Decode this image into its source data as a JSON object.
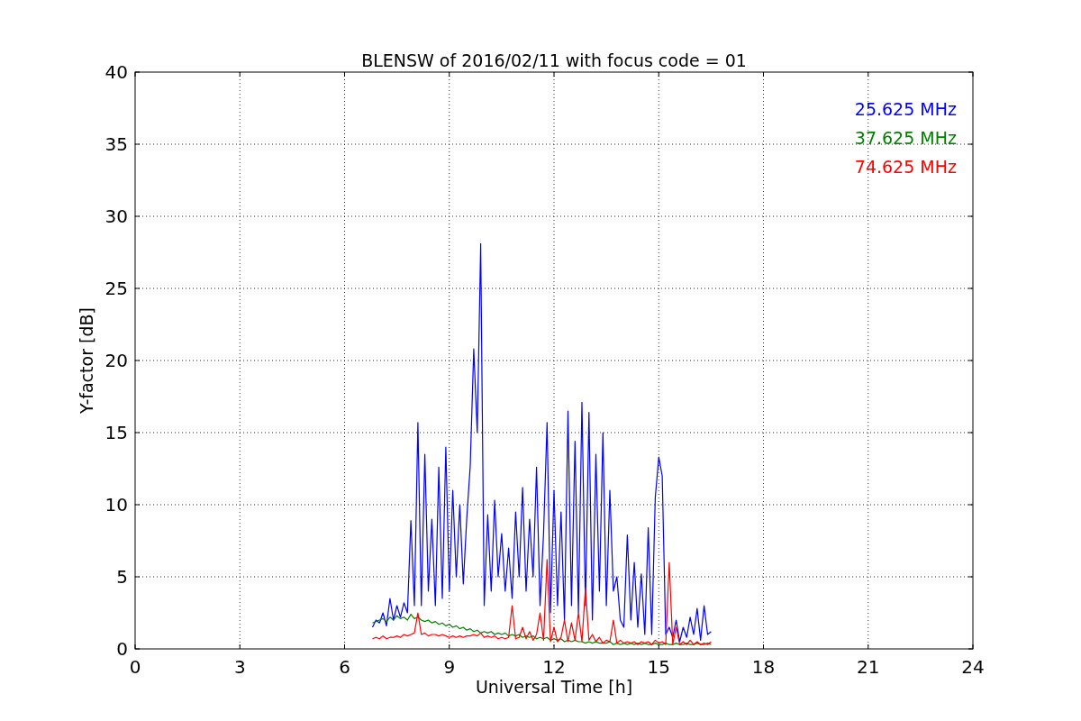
{
  "chart_data": {
    "type": "line",
    "title": "BLENSW of 2016/02/11 with focus code = 01",
    "xlabel": "Universal Time [h]",
    "ylabel": "Y-factor [dB]",
    "xlim": [
      0,
      24
    ],
    "ylim": [
      0,
      40
    ],
    "xticks": [
      0,
      3,
      6,
      9,
      12,
      15,
      18,
      21,
      24
    ],
    "yticks": [
      0,
      5,
      10,
      15,
      20,
      25,
      30,
      35,
      40
    ],
    "grid": true,
    "x": [
      6.8,
      6.9,
      7.0,
      7.1,
      7.2,
      7.3,
      7.4,
      7.5,
      7.6,
      7.7,
      7.8,
      7.9,
      8.0,
      8.1,
      8.2,
      8.3,
      8.4,
      8.5,
      8.6,
      8.7,
      8.8,
      8.9,
      9.0,
      9.1,
      9.2,
      9.3,
      9.4,
      9.5,
      9.6,
      9.7,
      9.8,
      9.9,
      10.0,
      10.1,
      10.2,
      10.3,
      10.4,
      10.5,
      10.6,
      10.7,
      10.8,
      10.9,
      11.0,
      11.1,
      11.2,
      11.3,
      11.4,
      11.5,
      11.6,
      11.7,
      11.8,
      11.9,
      12.0,
      12.1,
      12.2,
      12.3,
      12.4,
      12.5,
      12.6,
      12.7,
      12.8,
      12.9,
      13.0,
      13.1,
      13.2,
      13.3,
      13.4,
      13.5,
      13.6,
      13.7,
      13.8,
      13.9,
      14.0,
      14.1,
      14.2,
      14.3,
      14.4,
      14.5,
      14.6,
      14.7,
      14.8,
      14.9,
      15.0,
      15.1,
      15.2,
      15.3,
      15.4,
      15.5,
      15.6,
      15.7,
      15.8,
      15.9,
      16.0,
      16.1,
      16.2,
      16.3,
      16.4,
      16.5
    ],
    "series": [
      {
        "name": "25.625 MHz",
        "color": "#0000ff",
        "values": [
          1.5,
          2,
          1.8,
          2.5,
          1.6,
          3.5,
          2,
          3,
          2.2,
          3.2,
          2.5,
          8.9,
          3,
          15.7,
          3,
          13.5,
          4,
          9,
          3,
          12.6,
          3.5,
          14,
          4,
          11,
          5,
          10,
          4.5,
          9,
          12.7,
          20.8,
          15,
          28.1,
          3,
          9.3,
          4,
          10.3,
          5,
          8,
          4,
          7,
          3.5,
          9.5,
          5,
          11.2,
          4,
          9,
          5,
          12.6,
          3,
          8,
          15.7,
          2.5,
          11,
          3,
          9.5,
          2,
          16.5,
          3,
          14.4,
          2.5,
          17.1,
          3,
          16.4,
          2,
          13.5,
          4,
          15,
          3,
          11,
          4,
          5,
          2,
          1.5,
          7.9,
          2,
          6,
          1.5,
          5.2,
          1,
          8.4,
          1,
          10.5,
          13.3,
          12,
          1,
          1.5,
          0.8,
          2,
          0.5,
          1.5,
          0.8,
          2.2,
          1,
          2.8,
          0.6,
          3,
          1,
          1.2
        ]
      },
      {
        "name": "37.625 MHz",
        "color": "#008000",
        "values": [
          1.8,
          1.9,
          2,
          2.1,
          1.9,
          2.2,
          2,
          2.3,
          2.1,
          2.2,
          2,
          2.4,
          2.1,
          2.2,
          2,
          1.9,
          2,
          1.8,
          1.9,
          1.7,
          1.8,
          1.6,
          1.7,
          1.5,
          1.6,
          1.4,
          1.5,
          1.3,
          1.4,
          1.2,
          1.3,
          1.1,
          1.2,
          1.1,
          1.2,
          1,
          1.1,
          1,
          1.1,
          0.9,
          1,
          0.9,
          1,
          0.8,
          0.9,
          0.8,
          0.9,
          0.7,
          0.8,
          0.7,
          0.8,
          0.6,
          0.7,
          0.6,
          0.7,
          0.5,
          0.6,
          0.5,
          0.6,
          0.5,
          0.5,
          0.4,
          0.5,
          0.4,
          0.5,
          0.4,
          0.4,
          0.4,
          0.5,
          0.3,
          0.4,
          0.3,
          0.4,
          0.3,
          0.4,
          0.3,
          0.4,
          0.3,
          0.4,
          0.3,
          0.3,
          0.4,
          0.3,
          0.3,
          0.4,
          0.3,
          0.3,
          0.4,
          0.3,
          0.3,
          0.4,
          0.3,
          0.3,
          0.4,
          0.3,
          0.3,
          0.4,
          0.3
        ]
      },
      {
        "name": "74.625 MHz",
        "color": "#ff0000",
        "values": [
          0.7,
          0.8,
          0.7,
          0.9,
          0.7,
          0.8,
          0.8,
          0.9,
          0.8,
          1,
          0.9,
          1,
          1.1,
          2.5,
          1,
          1.1,
          0.9,
          1,
          1,
          0.9,
          1,
          0.9,
          0.8,
          0.9,
          0.8,
          0.9,
          0.8,
          0.9,
          0.9,
          1,
          0.9,
          1.1,
          0.8,
          0.9,
          0.8,
          0.9,
          0.7,
          0.8,
          0.7,
          0.8,
          3,
          0.7,
          0.8,
          1.5,
          0.7,
          1.2,
          0.6,
          1,
          2.5,
          0.6,
          6.2,
          0.5,
          1.5,
          0.5,
          0.8,
          2,
          0.5,
          1.8,
          0.6,
          2.5,
          0.5,
          4.2,
          0.6,
          1,
          0.5,
          0.8,
          0.4,
          0.6,
          0.5,
          2,
          0.4,
          0.6,
          0.4,
          0.5,
          0.4,
          0.5,
          0.3,
          0.5,
          0.4,
          0.5,
          0.3,
          0.6,
          0.4,
          0.5,
          0.3,
          6,
          0.3,
          1.5,
          0.3,
          0.5,
          0.3,
          0.6,
          0.3,
          0.5,
          0.3,
          0.4,
          0.3,
          0.5
        ]
      }
    ]
  }
}
